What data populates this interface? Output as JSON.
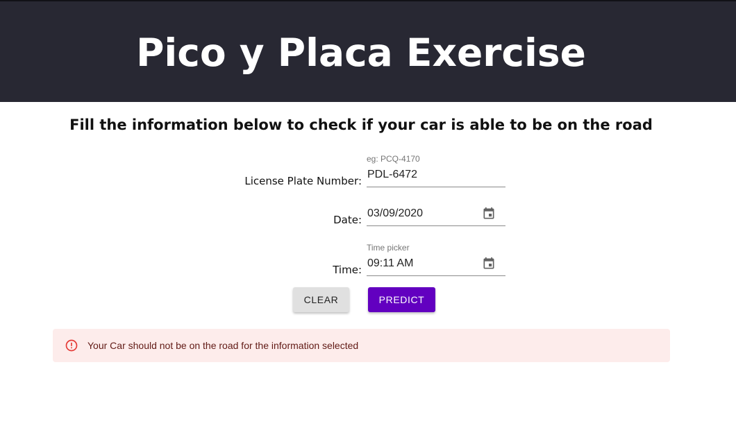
{
  "header": {
    "title": "Pico y Placa Exercise"
  },
  "subtitle": "Fill the information below to check if your car is able to be on the road",
  "form": {
    "plate": {
      "label": "License Plate Number:",
      "helper": "eg: PCQ-4170",
      "value": "PDL-6472"
    },
    "date": {
      "label": "Date:",
      "value": "03/09/2020",
      "icon": "calendar-icon"
    },
    "time": {
      "label": "Time:",
      "helper": "Time picker",
      "value": "09:11 AM",
      "icon": "calendar-icon"
    }
  },
  "buttons": {
    "clear_label": "Clear",
    "predict_label": "Predict"
  },
  "alert": {
    "icon": "error-outline-icon",
    "message": "Your Car should not be on the road for the information selected"
  },
  "colors": {
    "header_bg": "#282833",
    "primary": "#6200c0",
    "alert_bg": "#fdeceb",
    "alert_icon": "#e53935",
    "alert_text": "#611a15"
  }
}
